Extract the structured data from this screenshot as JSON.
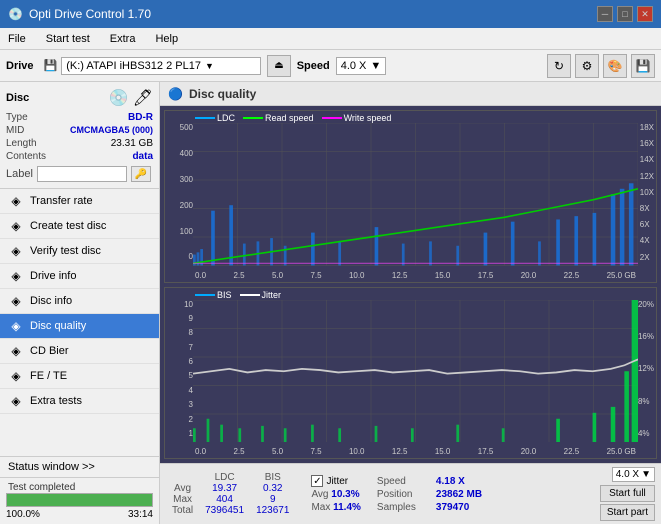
{
  "titleBar": {
    "title": "Opti Drive Control 1.70",
    "controls": [
      "minimize",
      "maximize",
      "close"
    ]
  },
  "menuBar": {
    "items": [
      "File",
      "Start test",
      "Extra",
      "Help"
    ]
  },
  "driveToolbar": {
    "driveLabel": "Drive",
    "driveValue": "(K:)  ATAPI iHBS312  2 PL17",
    "speedLabel": "Speed",
    "speedValue": "4.0 X"
  },
  "discPanel": {
    "type": {
      "label": "Type",
      "value": "BD-R"
    },
    "mid": {
      "label": "MID",
      "value": "CMCMAGBA5 (000)"
    },
    "length": {
      "label": "Length",
      "value": "23.31 GB"
    },
    "contents": {
      "label": "Contents",
      "value": "data"
    },
    "labelField": {
      "label": "Label",
      "value": ""
    }
  },
  "navItems": [
    {
      "id": "transfer-rate",
      "label": "Transfer rate",
      "icon": "◈"
    },
    {
      "id": "create-test-disc",
      "label": "Create test disc",
      "icon": "◈"
    },
    {
      "id": "verify-test-disc",
      "label": "Verify test disc",
      "icon": "◈"
    },
    {
      "id": "drive-info",
      "label": "Drive info",
      "icon": "◈"
    },
    {
      "id": "disc-info",
      "label": "Disc info",
      "icon": "◈"
    },
    {
      "id": "disc-quality",
      "label": "Disc quality",
      "icon": "◈",
      "active": true
    },
    {
      "id": "cd-bier",
      "label": "CD Bier",
      "icon": "◈"
    },
    {
      "id": "fe-te",
      "label": "FE / TE",
      "icon": "◈"
    },
    {
      "id": "extra-tests",
      "label": "Extra tests",
      "icon": "◈"
    }
  ],
  "statusWindow": {
    "label": "Status window >>",
    "arrow": ">>"
  },
  "progress": {
    "percent": 100,
    "time": "33:14",
    "status": "Test completed"
  },
  "qualityPanel": {
    "title": "Disc quality",
    "chart1": {
      "legend": [
        "LDC",
        "Read speed",
        "Write speed"
      ],
      "yAxisLeft": [
        "500",
        "400",
        "300",
        "200",
        "100",
        "0"
      ],
      "yAxisRight": [
        "18X",
        "16X",
        "14X",
        "12X",
        "10X",
        "8X",
        "6X",
        "4X",
        "2X"
      ],
      "xAxis": [
        "0.0",
        "2.5",
        "5.0",
        "7.5",
        "10.0",
        "12.5",
        "15.0",
        "17.5",
        "20.0",
        "22.5",
        "25.0 GB"
      ]
    },
    "chart2": {
      "legend": [
        "BIS",
        "Jitter"
      ],
      "yAxisLeft": [
        "10",
        "9",
        "8",
        "7",
        "6",
        "5",
        "4",
        "3",
        "2",
        "1"
      ],
      "yAxisRight": [
        "20%",
        "16%",
        "12%",
        "8%",
        "4%"
      ],
      "xAxis": [
        "0.0",
        "2.5",
        "5.0",
        "7.5",
        "10.0",
        "12.5",
        "15.0",
        "17.5",
        "20.0",
        "22.5",
        "25.0 GB"
      ]
    }
  },
  "stats": {
    "columns": [
      "",
      "LDC",
      "BIS"
    ],
    "rows": [
      {
        "label": "Avg",
        "ldc": "19.37",
        "bis": "0.32"
      },
      {
        "label": "Max",
        "ldc": "404",
        "bis": "9"
      },
      {
        "label": "Total",
        "ldc": "7396451",
        "bis": "123671"
      }
    ],
    "jitter": {
      "checked": true,
      "label": "Jitter",
      "avg": "10.3%",
      "max": "11.4%"
    },
    "speed": {
      "speedVal": "4.18 X",
      "speedLabel": "Speed",
      "positionLabel": "Position",
      "positionVal": "23862 MB",
      "samplesLabel": "Samples",
      "samplesVal": "379470",
      "selectVal": "4.0 X"
    },
    "buttons": {
      "startFull": "Start full",
      "startPart": "Start part"
    }
  }
}
